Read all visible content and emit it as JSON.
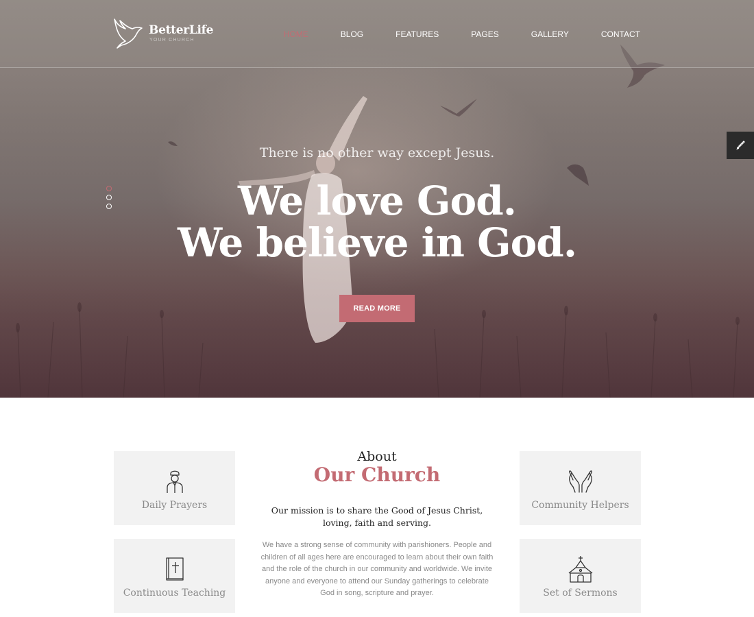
{
  "brand": {
    "name": "BetterLife",
    "tagline": "YOUR CHURCH"
  },
  "nav": {
    "items": [
      {
        "label": "HOME",
        "active": true
      },
      {
        "label": "BLOG"
      },
      {
        "label": "FEATURES"
      },
      {
        "label": "PAGES"
      },
      {
        "label": "GALLERY"
      },
      {
        "label": "CONTACT"
      }
    ]
  },
  "hero": {
    "subtitle": "There is no other way except Jesus.",
    "title_line1": "We love God.",
    "title_line2": "We believe in God.",
    "cta_label": "READ MORE",
    "slides": {
      "count": 3,
      "active": 1
    }
  },
  "about": {
    "kicker": "About",
    "title": "Our Church",
    "mission": "Our mission is to share the Good of Jesus Christ, loving, faith and serving.",
    "body": "We have a strong sense of community with parishioners. People and children of all ages here are encouraged to learn about their own faith and the role of the church in our community and worldwide. We invite anyone and everyone to attend our Sunday gatherings to celebrate God in song, scripture and prayer.",
    "cards": [
      {
        "label": "Daily Prayers",
        "icon": "priest-icon"
      },
      {
        "label": "Community Helpers",
        "icon": "praying-hands-icon"
      },
      {
        "label": "Continuous Teaching",
        "icon": "bible-icon"
      },
      {
        "label": "Set of Sermons",
        "icon": "church-icon"
      }
    ]
  },
  "colors": {
    "accent": "#c36b73",
    "dark": "#2b2b2b",
    "card_bg": "#f2f2f2"
  }
}
